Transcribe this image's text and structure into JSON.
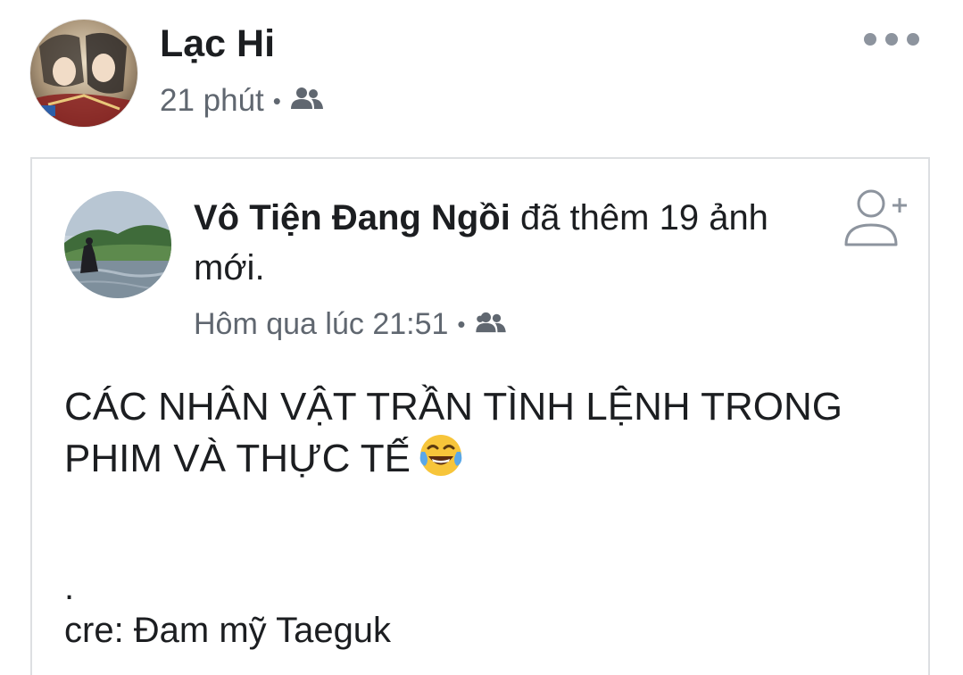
{
  "post": {
    "author": "Lạc Hi",
    "time": "21 phút",
    "separator": "•",
    "audience_icon": "group-icon",
    "more_icon": "more-horizontal-icon"
  },
  "shared": {
    "author": "Vô Tiện Đang Ngồi",
    "action": " đã thêm 19 ảnh mới.",
    "time": "Hôm qua lúc 21:51",
    "separator": "•",
    "audience_icon": "group-icon",
    "follow_icon": "add-friend-icon",
    "caption_line1": "CÁC NHÂN VẬT TRẦN TÌNH LỆNH TRONG",
    "caption_line2": "PHIM VÀ THỰC TẾ",
    "emoji": "😂",
    "dot": ".",
    "credit": "cre: Đam mỹ Taeguk"
  },
  "colors": {
    "text_primary": "#1c1e21",
    "text_secondary": "#606770",
    "icon_gray": "#8d949e",
    "card_border": "#dddfe2"
  }
}
